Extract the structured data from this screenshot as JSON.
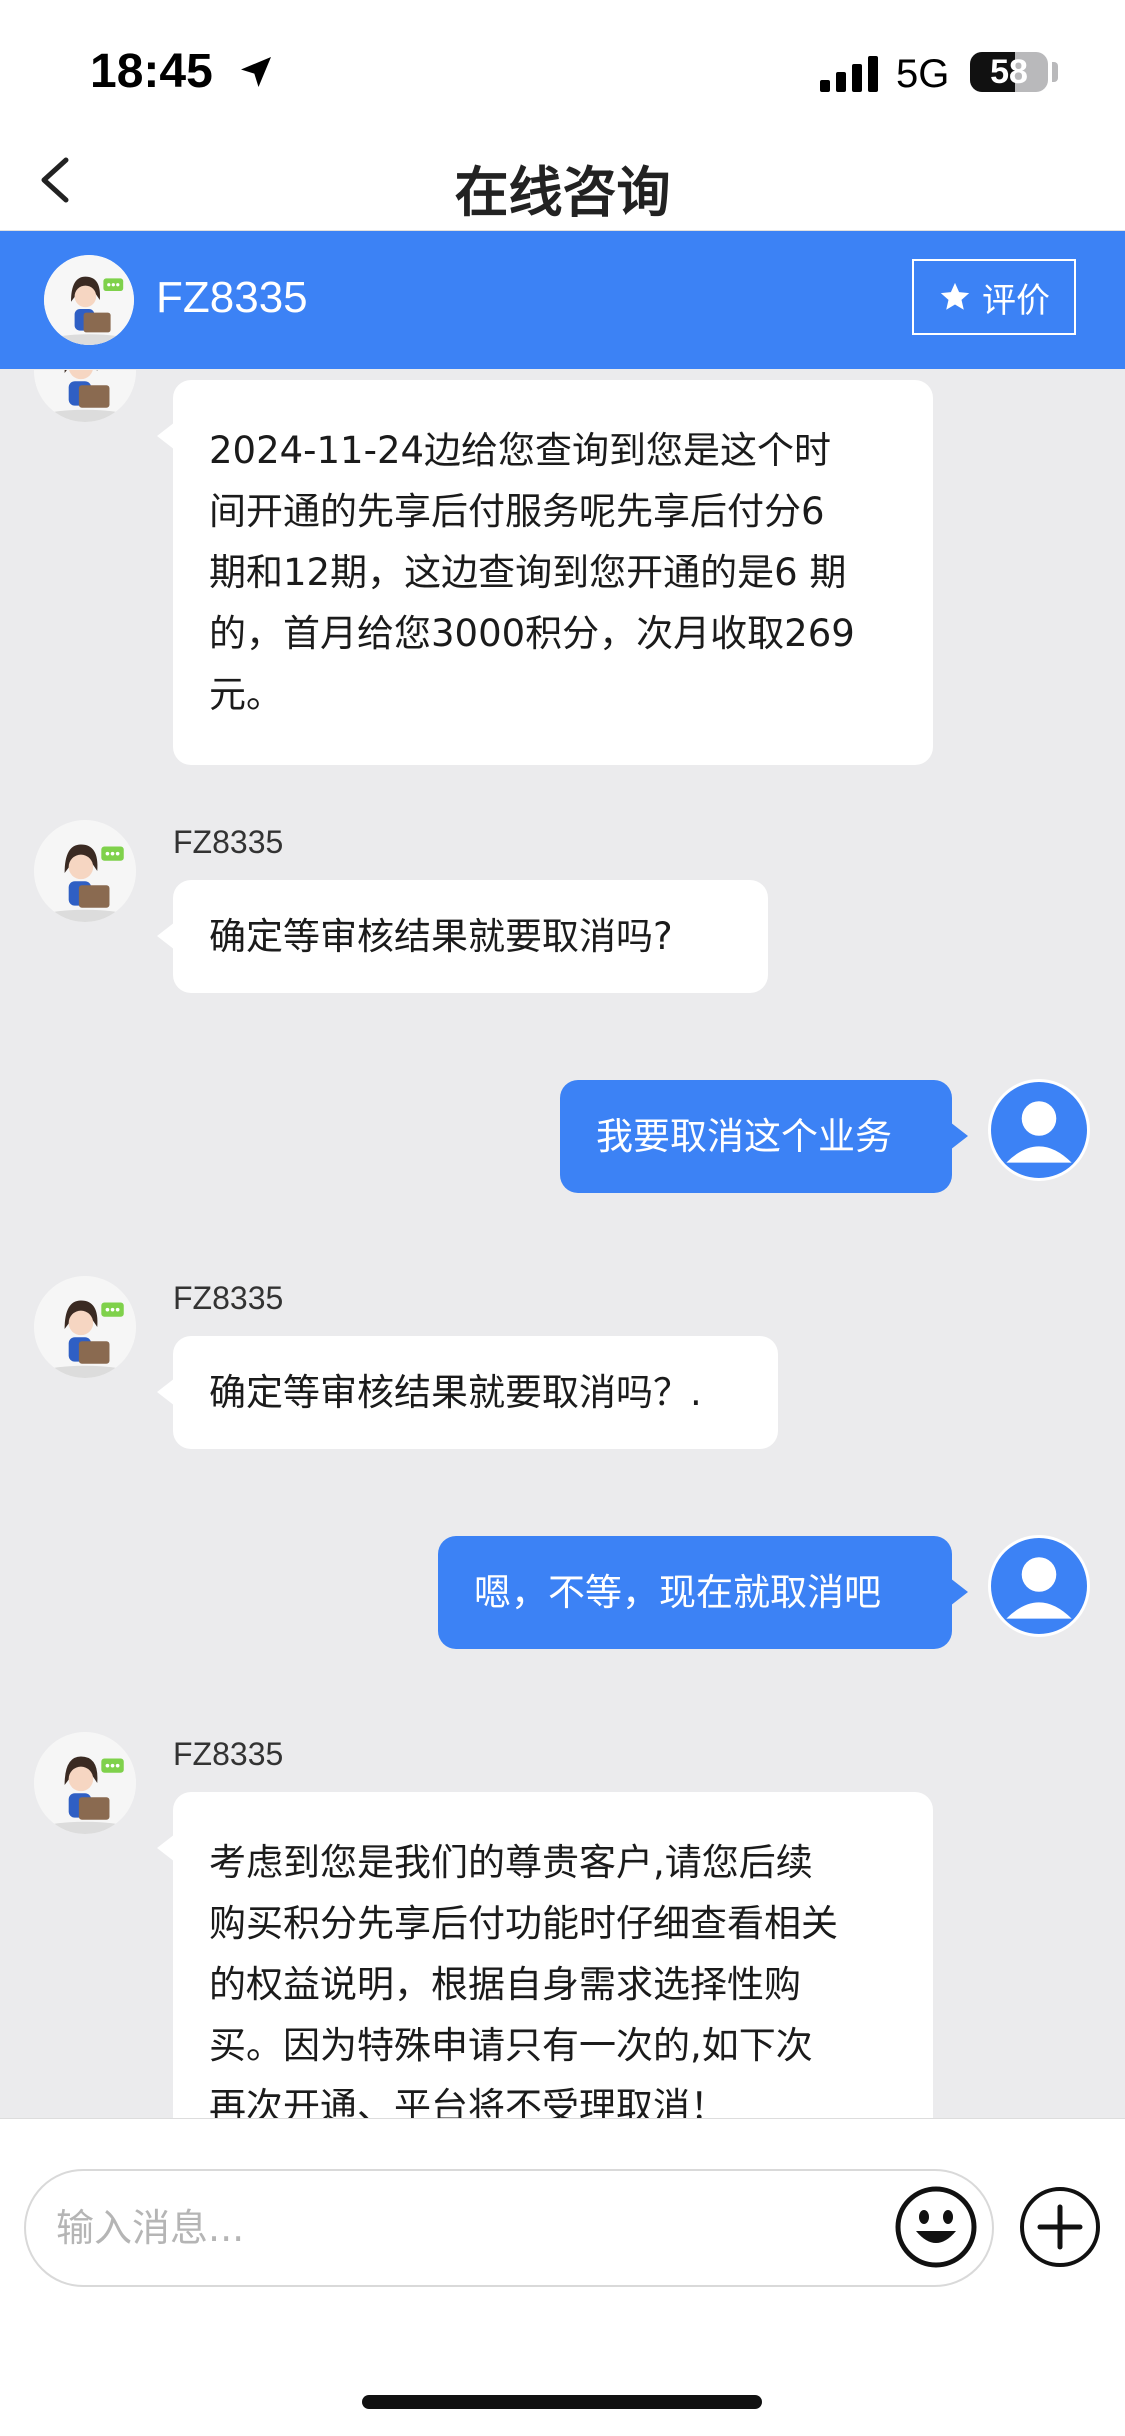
{
  "status_bar": {
    "time": "18:45",
    "network": "5G",
    "battery": "58",
    "icons": [
      "location-arrow-icon",
      "signal-icon",
      "battery-icon"
    ]
  },
  "nav": {
    "title": "在线咨询",
    "back_icon": "chevron-left-icon"
  },
  "agent": {
    "name": "FZ8335",
    "rate_label": "评价",
    "rate_icon": "star-icon"
  },
  "colors": {
    "accent": "#3c82f5",
    "chat_bg": "#ebebed",
    "bubble_left": "#ffffff"
  },
  "messages": [
    {
      "from": "agent",
      "sender": "",
      "lines": [
        "2024-11-24边给您查询到您是这个时",
        "间开通的先享后付服务呢先享后付分6",
        "期和12期，这边查询到您开通的是6 期",
        "的，首月给您3000积分，次月收取269",
        "元。"
      ]
    },
    {
      "from": "agent",
      "sender": "FZ8335",
      "lines": [
        "确定等审核结果就要取消吗?"
      ]
    },
    {
      "from": "user",
      "lines": [
        "我要取消这个业务"
      ]
    },
    {
      "from": "agent",
      "sender": "FZ8335",
      "lines": [
        "确定等审核结果就要取消吗？."
      ]
    },
    {
      "from": "user",
      "lines": [
        "嗯，不等，现在就取消吧"
      ]
    },
    {
      "from": "agent",
      "sender": "FZ8335",
      "lines": [
        "考虑到您是我们的尊贵客户,请您后续",
        "购买积分先享后付功能时仔细查看相关",
        "的权益说明，根据自身需求选择性购",
        "买。因为特殊申请只有一次的,如下次",
        "再次开通、平台将不受理取消！"
      ]
    }
  ],
  "input": {
    "placeholder": "输入消息...",
    "value": "",
    "emoji_icon": "smiley-face-icon",
    "plus_icon": "plus-circle-icon"
  }
}
